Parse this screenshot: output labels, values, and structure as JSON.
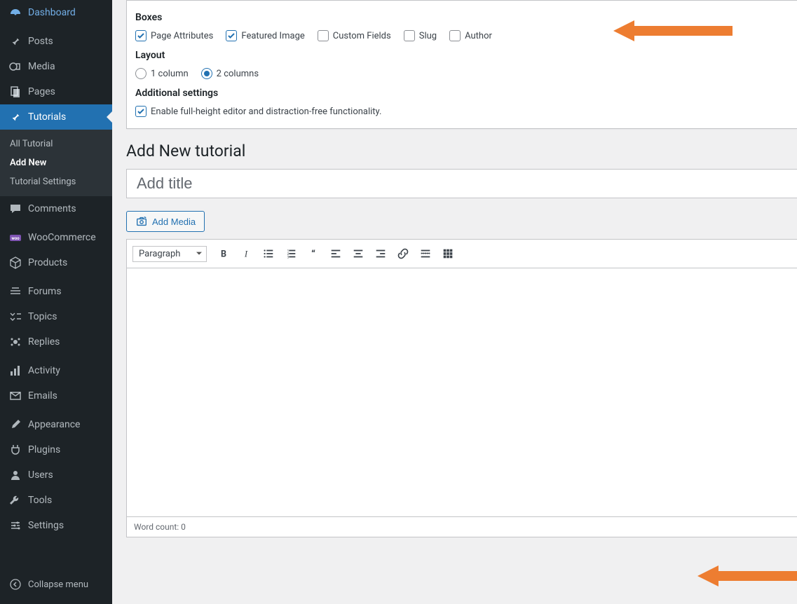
{
  "sidebar": {
    "items": [
      {
        "label": "Dashboard",
        "icon": "dashboard"
      },
      {
        "label": "Posts",
        "icon": "pin"
      },
      {
        "label": "Media",
        "icon": "media"
      },
      {
        "label": "Pages",
        "icon": "pages"
      },
      {
        "label": "Tutorials",
        "icon": "pin",
        "current": true
      },
      {
        "label": "Comments",
        "icon": "comment"
      },
      {
        "label": "WooCommerce",
        "icon": "woo"
      },
      {
        "label": "Products",
        "icon": "box"
      },
      {
        "label": "Forums",
        "icon": "forums"
      },
      {
        "label": "Topics",
        "icon": "topics"
      },
      {
        "label": "Replies",
        "icon": "replies"
      },
      {
        "label": "Activity",
        "icon": "activity"
      },
      {
        "label": "Emails",
        "icon": "email"
      },
      {
        "label": "Appearance",
        "icon": "brush"
      },
      {
        "label": "Plugins",
        "icon": "plug"
      },
      {
        "label": "Users",
        "icon": "users"
      },
      {
        "label": "Tools",
        "icon": "tools"
      },
      {
        "label": "Settings",
        "icon": "settings"
      }
    ],
    "submenu": [
      {
        "label": "All Tutorial"
      },
      {
        "label": "Add New",
        "current": true
      },
      {
        "label": "Tutorial Settings"
      }
    ],
    "collapse": "Collapse menu"
  },
  "screen_options": {
    "boxes_heading": "Boxes",
    "boxes": [
      {
        "label": "Page Attributes",
        "checked": true
      },
      {
        "label": "Featured Image",
        "checked": true
      },
      {
        "label": "Custom Fields",
        "checked": false
      },
      {
        "label": "Slug",
        "checked": false
      },
      {
        "label": "Author",
        "checked": false
      }
    ],
    "layout_heading": "Layout",
    "layout": [
      {
        "label": "1 column",
        "checked": false
      },
      {
        "label": "2 columns",
        "checked": true
      }
    ],
    "additional_heading": "Additional settings",
    "additional_label": "Enable full-height editor and distraction-free functionality.",
    "additional_checked": true
  },
  "page": {
    "title": "Add New tutorial",
    "title_placeholder": "Add title",
    "add_media": "Add Media",
    "paragraph_label": "Paragraph",
    "word_count": "Word count: 0"
  }
}
